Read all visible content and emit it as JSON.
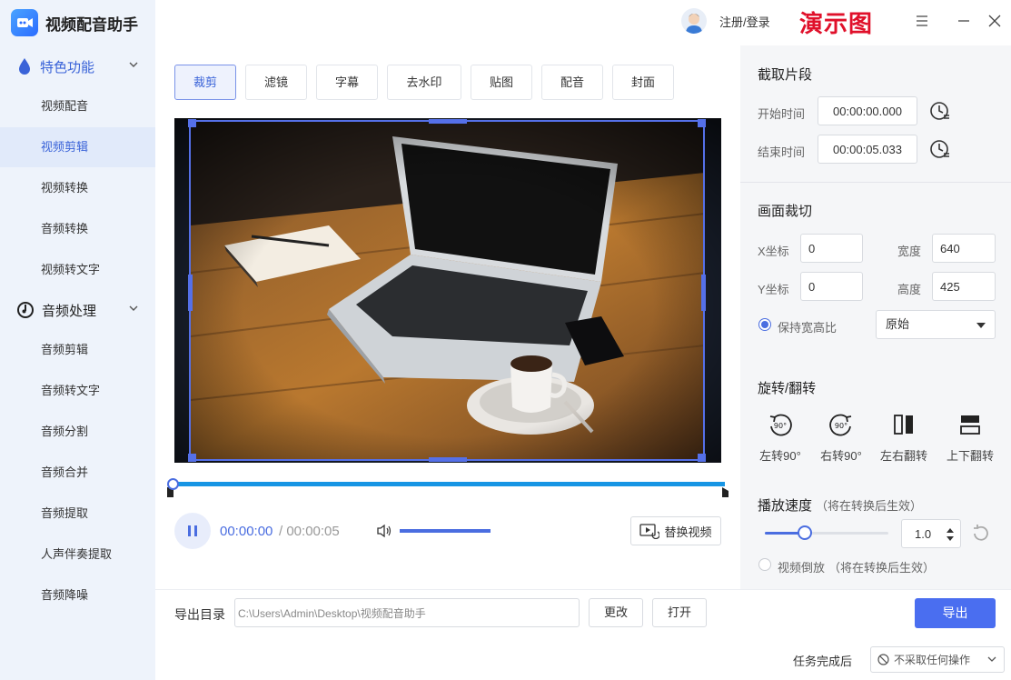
{
  "app": {
    "title": "视频配音助手",
    "login": "注册/登录",
    "watermark": "演示图"
  },
  "sidebar": {
    "groups": [
      {
        "label": "特色功能",
        "items": [
          "视频配音",
          "视频剪辑",
          "视频转换",
          "音频转换",
          "视频转文字"
        ]
      },
      {
        "label": "音频处理",
        "items": [
          "音频剪辑",
          "音频转文字",
          "音频分割",
          "音频合并",
          "音频提取",
          "人声伴奏提取",
          "音频降噪"
        ]
      }
    ],
    "active_item": "视频剪辑"
  },
  "tabs": [
    "裁剪",
    "滤镜",
    "字幕",
    "去水印",
    "贴图",
    "配音",
    "封面"
  ],
  "active_tab": "裁剪",
  "player": {
    "current_time": "00:00:00",
    "separator": "/",
    "total_time": "00:00:05",
    "replace_label": "替换视频",
    "progress": 0,
    "volume": 1.0
  },
  "clip": {
    "title": "截取片段",
    "start_label": "开始时间",
    "start_value": "00:00:00.000",
    "end_label": "结束时间",
    "end_value": "00:00:05.033"
  },
  "crop": {
    "title": "画面裁切",
    "x_label": "X坐标",
    "x_value": "0",
    "y_label": "Y坐标",
    "y_value": "0",
    "w_label": "宽度",
    "w_value": "640",
    "h_label": "高度",
    "h_value": "425",
    "keep_ratio_label": "保持宽高比",
    "keep_ratio_checked": true,
    "ratio_option": "原始"
  },
  "rotate": {
    "title": "旋转/翻转",
    "items": [
      "左转90°",
      "右转90°",
      "左右翻转",
      "上下翻转"
    ],
    "badge": "90°"
  },
  "speed": {
    "title": "播放速度",
    "note": "（将在转换后生效）",
    "value": "1.0",
    "reverse_label": "视频倒放",
    "reverse_note": "（将在转换后生效）"
  },
  "export": {
    "dir_label": "导出目录",
    "path": "C:\\Users\\Admin\\Desktop\\视频配音助手",
    "change_label": "更改",
    "open_label": "打开",
    "export_label": "导出",
    "after_label": "任务完成后",
    "after_option": "不采取任何操作"
  },
  "colors": {
    "accent": "#4a6de0",
    "timeline": "#1795e4",
    "watermark": "#e0102a",
    "sidebar_bg": "#eef3fb"
  }
}
